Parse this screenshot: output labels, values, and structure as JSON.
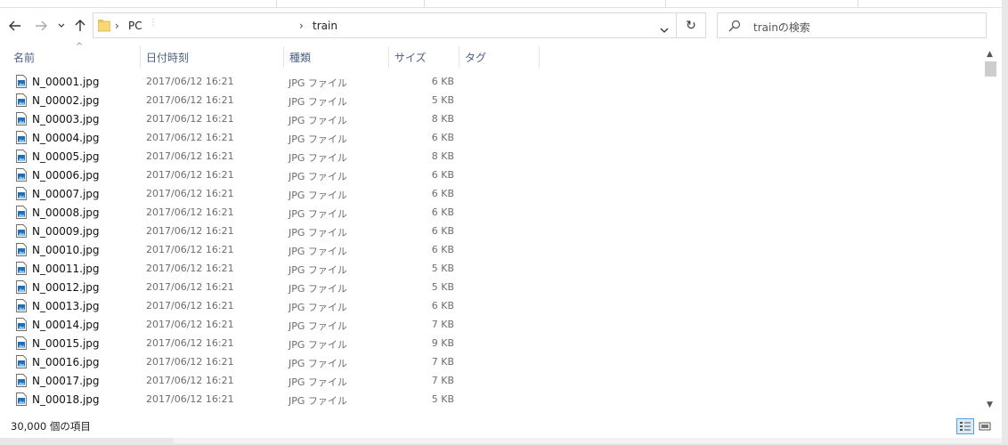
{
  "nav": {
    "back_icon": "arrow-left-icon",
    "forward_icon": "arrow-right-icon",
    "recent_icon": "chevron-down-icon",
    "up_icon": "arrow-up-icon"
  },
  "address": {
    "breadcrumbs": [
      "PC",
      "train"
    ],
    "separator": "›",
    "dots": "⋮"
  },
  "refresh": {
    "symbol": "↻"
  },
  "search": {
    "placeholder": "trainの検索"
  },
  "columns": {
    "name": "名前",
    "date": "日付時刻",
    "type": "種類",
    "size": "サイズ",
    "tag": "タグ",
    "sort_indicator": "^"
  },
  "files": [
    {
      "name": "N_00001.jpg",
      "date": "2017/06/12 16:21",
      "type": "JPG ファイル",
      "size": "6 KB"
    },
    {
      "name": "N_00002.jpg",
      "date": "2017/06/12 16:21",
      "type": "JPG ファイル",
      "size": "5 KB"
    },
    {
      "name": "N_00003.jpg",
      "date": "2017/06/12 16:21",
      "type": "JPG ファイル",
      "size": "8 KB"
    },
    {
      "name": "N_00004.jpg",
      "date": "2017/06/12 16:21",
      "type": "JPG ファイル",
      "size": "6 KB"
    },
    {
      "name": "N_00005.jpg",
      "date": "2017/06/12 16:21",
      "type": "JPG ファイル",
      "size": "8 KB"
    },
    {
      "name": "N_00006.jpg",
      "date": "2017/06/12 16:21",
      "type": "JPG ファイル",
      "size": "6 KB"
    },
    {
      "name": "N_00007.jpg",
      "date": "2017/06/12 16:21",
      "type": "JPG ファイル",
      "size": "6 KB"
    },
    {
      "name": "N_00008.jpg",
      "date": "2017/06/12 16:21",
      "type": "JPG ファイル",
      "size": "6 KB"
    },
    {
      "name": "N_00009.jpg",
      "date": "2017/06/12 16:21",
      "type": "JPG ファイル",
      "size": "6 KB"
    },
    {
      "name": "N_00010.jpg",
      "date": "2017/06/12 16:21",
      "type": "JPG ファイル",
      "size": "6 KB"
    },
    {
      "name": "N_00011.jpg",
      "date": "2017/06/12 16:21",
      "type": "JPG ファイル",
      "size": "5 KB"
    },
    {
      "name": "N_00012.jpg",
      "date": "2017/06/12 16:21",
      "type": "JPG ファイル",
      "size": "5 KB"
    },
    {
      "name": "N_00013.jpg",
      "date": "2017/06/12 16:21",
      "type": "JPG ファイル",
      "size": "6 KB"
    },
    {
      "name": "N_00014.jpg",
      "date": "2017/06/12 16:21",
      "type": "JPG ファイル",
      "size": "7 KB"
    },
    {
      "name": "N_00015.jpg",
      "date": "2017/06/12 16:21",
      "type": "JPG ファイル",
      "size": "9 KB"
    },
    {
      "name": "N_00016.jpg",
      "date": "2017/06/12 16:21",
      "type": "JPG ファイル",
      "size": "7 KB"
    },
    {
      "name": "N_00017.jpg",
      "date": "2017/06/12 16:21",
      "type": "JPG ファイル",
      "size": "7 KB"
    },
    {
      "name": "N_00018.jpg",
      "date": "2017/06/12 16:21",
      "type": "JPG ファイル",
      "size": "5 KB"
    }
  ],
  "status": {
    "item_count": "30,000 個の項目",
    "details_view_icon": "details-view-icon",
    "large_icons_view_icon": "large-icons-view-icon"
  },
  "colors": {
    "header_text": "#4d6082",
    "secondary_text": "#6d6d6d",
    "folder": "#f8d775",
    "view_active_border": "#5aa0e0"
  }
}
